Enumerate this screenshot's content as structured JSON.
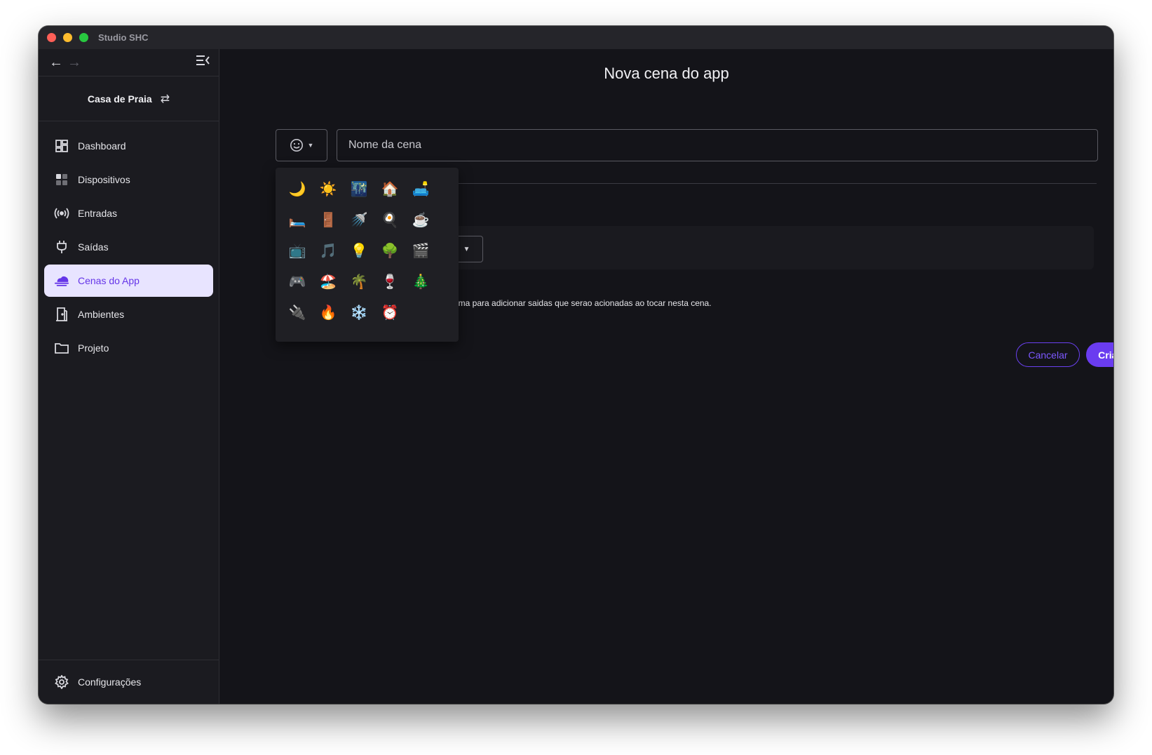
{
  "window": {
    "title": "Studio SHC"
  },
  "sidebar": {
    "project_name": "Casa de Praia",
    "items": [
      {
        "label": "Dashboard",
        "icon": "dashboard-icon",
        "active": false
      },
      {
        "label": "Dispositivos",
        "icon": "devices-icon",
        "active": false
      },
      {
        "label": "Entradas",
        "icon": "inputs-icon",
        "active": false
      },
      {
        "label": "Saídas",
        "icon": "plug-icon",
        "active": false
      },
      {
        "label": "Cenas do App",
        "icon": "cloud-icon",
        "active": true
      },
      {
        "label": "Ambientes",
        "icon": "door-icon",
        "active": false
      },
      {
        "label": "Projeto",
        "icon": "folder-icon",
        "active": false
      }
    ],
    "settings_label": "Configurações"
  },
  "main": {
    "title": "Nova cena do app",
    "name_placeholder": "Nome da cena",
    "hint": "cima para adicionar saidas que serao acionadas ao tocar nesta cena.",
    "cancel_label": "Cancelar",
    "create_label": "Criar"
  },
  "emoji_picker": {
    "emojis": [
      "🌙",
      "☀️",
      "🌃",
      "🏠",
      "🛋️",
      "🛏️",
      "🚪",
      "🚿",
      "🍳",
      "☕",
      "📺",
      "🎵",
      "💡",
      "🌳",
      "🎬",
      "🎮",
      "🏖️",
      "🌴",
      "🍷",
      "🎄",
      "🔌",
      "🔥",
      "❄️",
      "⏰"
    ]
  },
  "colors": {
    "accent": "#6a3cf0",
    "active_bg": "#e8e4ff",
    "background": "#141419"
  }
}
